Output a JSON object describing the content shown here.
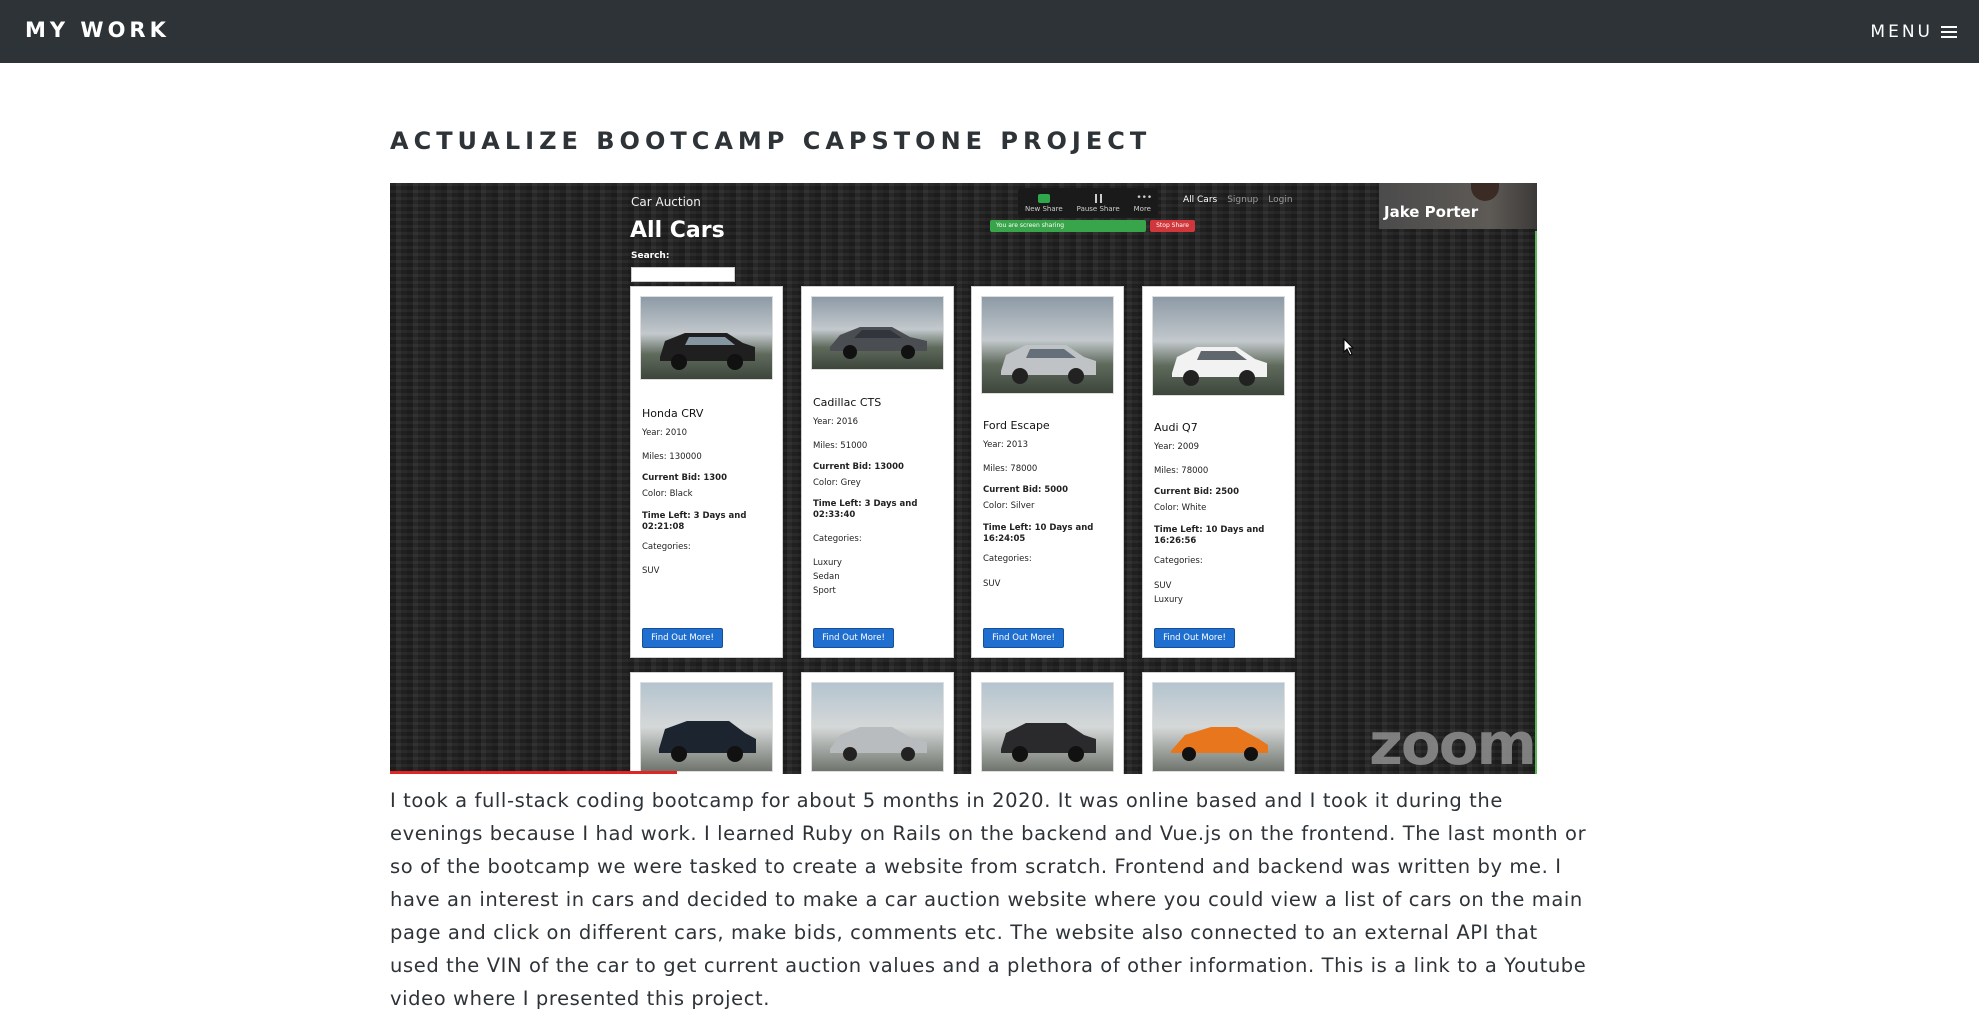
{
  "header": {
    "brand": "MY WORK",
    "menu_label": "MENU"
  },
  "section": {
    "title": "ACTUALIZE BOOTCAMP CAPSTONE PROJECT"
  },
  "video": {
    "app_name": "Car Auction",
    "page_heading": "All Cars",
    "search_label": "Search:",
    "nav": [
      "All Cars",
      "Signup",
      "Login"
    ],
    "zoom_toolbar": [
      "New Share",
      "Pause Share",
      "More"
    ],
    "share_banner": "You are screen sharing",
    "stop_share": "Stop Share",
    "participant_name": "Jake Porter",
    "watermark": "zoom",
    "progress": 0.25,
    "cars": [
      {
        "name": "Honda CRV",
        "year": "Year: 2010",
        "miles": "Miles: 130000",
        "bid": "Current Bid: 1300",
        "color": "Color: Black",
        "time_left": "Time Left: 3 Days and 02:21:08",
        "categories_label": "Categories:",
        "categories": [
          "SUV"
        ],
        "button": "Find Out More!",
        "body_color": "#1f1f1f"
      },
      {
        "name": "Cadillac CTS",
        "year": "Year: 2016",
        "miles": "Miles: 51000",
        "bid": "Current Bid: 13000",
        "color": "Color: Grey",
        "time_left": "Time Left: 3 Days and 02:33:40",
        "categories_label": "Categories:",
        "categories": [
          "Luxury",
          "Sedan",
          "Sport"
        ],
        "button": "Find Out More!",
        "body_color": "#4a4d52"
      },
      {
        "name": "Ford Escape",
        "year": "Year: 2013",
        "miles": "Miles: 78000",
        "bid": "Current Bid: 5000",
        "color": "Color: Silver",
        "time_left": "Time Left: 10 Days and 16:24:05",
        "categories_label": "Categories:",
        "categories": [
          "SUV"
        ],
        "button": "Find Out More!",
        "body_color": "#bfc3c6"
      },
      {
        "name": "Audi Q7",
        "year": "Year: 2009",
        "miles": "Miles: 78000",
        "bid": "Current Bid: 2500",
        "color": "Color: White",
        "time_left": "Time Left: 10 Days and 16:26:56",
        "categories_label": "Categories:",
        "categories": [
          "SUV",
          "Luxury"
        ],
        "button": "Find Out More!",
        "body_color": "#f2f2f2"
      }
    ],
    "second_row_colors": [
      "#1c2430",
      "#b9bcbf",
      "#2a2a2c",
      "#e8761c"
    ]
  },
  "description": "I took a full-stack coding bootcamp for about 5 months in 2020. It was online based and I took it during the evenings because I had work. I learned Ruby on Rails on the backend and Vue.js on the frontend. The last month or so of the bootcamp we were tasked to create a website from scratch. Frontend and backend was written by me. I have an interest in cars and decided to make a car auction website where you could view a list of cars on the main page and click on different cars, make bids, comments etc. The website also connected to an external API that used the VIN of the car to get current auction values and a plethora of other information. This is a link to a Youtube video where I presented this project."
}
